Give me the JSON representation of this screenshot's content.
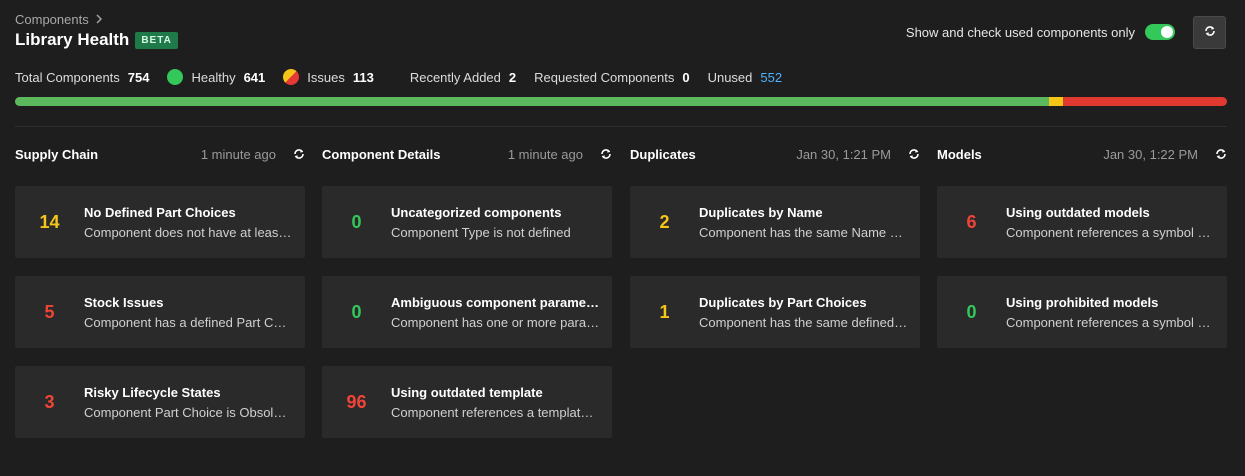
{
  "breadcrumb": {
    "parent": "Components"
  },
  "header": {
    "title": "Library Health",
    "badge": "BETA"
  },
  "toggle": {
    "label": "Show and check used components only",
    "on": true
  },
  "stats": {
    "total_label": "Total Components",
    "total_value": "754",
    "healthy_label": "Healthy",
    "healthy_value": "641",
    "issues_label": "Issues",
    "issues_value": "113",
    "recent_label": "Recently Added",
    "recent_value": "2",
    "requested_label": "Requested Components",
    "requested_value": "0",
    "unused_label": "Unused",
    "unused_value": "552"
  },
  "progress": {
    "healthy": 0.853,
    "warning": 0.012,
    "error": 0.135,
    "colors": {
      "healthy": "#5cb85c",
      "warning": "#f5c518",
      "error": "#e0392f"
    }
  },
  "colors": {
    "yellow": "#f5c518",
    "red": "#f04438",
    "green": "#34c759"
  },
  "sections": [
    {
      "title": "Supply Chain",
      "time": "1 minute ago",
      "cards": [
        {
          "count": "14",
          "color": "yellow",
          "title": "No Defined Part Choices",
          "desc": "Component does not have at least one defined Part Choice"
        },
        {
          "count": "5",
          "color": "red",
          "title": "Stock Issues",
          "desc": "Component has a defined Part Choice with stock issues"
        },
        {
          "count": "3",
          "color": "red",
          "title": "Risky Lifecycle States",
          "desc": "Component Part Choice is Obsolete or at risk"
        }
      ]
    },
    {
      "title": "Component Details",
      "time": "1 minute ago",
      "cards": [
        {
          "count": "0",
          "color": "green",
          "title": "Uncategorized components",
          "desc": "Component Type is not defined"
        },
        {
          "count": "0",
          "color": "green",
          "title": "Ambiguous component parameters",
          "desc": "Component has one or more parameters that are ambiguous"
        },
        {
          "count": "96",
          "color": "red",
          "title": "Using outdated template",
          "desc": "Component references a template that is outdated"
        }
      ]
    },
    {
      "title": "Duplicates",
      "time": "Jan 30, 1:21 PM",
      "cards": [
        {
          "count": "2",
          "color": "yellow",
          "title": "Duplicates by Name",
          "desc": "Component has the same Name as another component"
        },
        {
          "count": "1",
          "color": "yellow",
          "title": "Duplicates by Part Choices",
          "desc": "Component has the same defined Part Choices"
        }
      ]
    },
    {
      "title": "Models",
      "time": "Jan 30, 1:22 PM",
      "cards": [
        {
          "count": "6",
          "color": "red",
          "title": "Using outdated models",
          "desc": "Component references a symbol or footprint that is outdated"
        },
        {
          "count": "0",
          "color": "green",
          "title": "Using prohibited models",
          "desc": "Component references a symbol or footprint that is prohibited"
        }
      ]
    }
  ]
}
